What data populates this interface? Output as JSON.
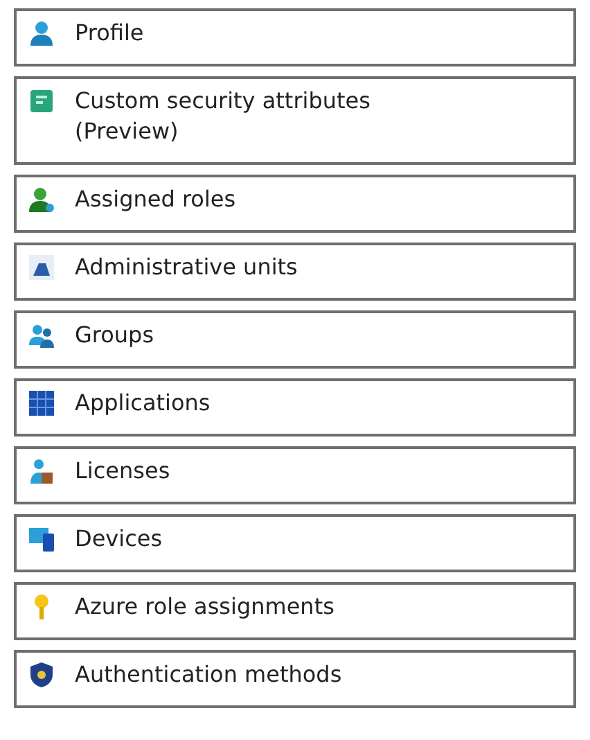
{
  "menu_items": [
    {
      "label": "Profile",
      "kind": "person"
    },
    {
      "label": "Custom security attributes (Preview)",
      "kind": "attributes"
    },
    {
      "label": "Assigned roles",
      "kind": "roles"
    },
    {
      "label": "Administrative units",
      "kind": "units"
    },
    {
      "label": "Groups",
      "kind": "groups"
    },
    {
      "label": "Applications",
      "kind": "apps"
    },
    {
      "label": "Licenses",
      "kind": "licenses"
    },
    {
      "label": "Devices",
      "kind": "devices"
    },
    {
      "label": "Azure role assignments",
      "kind": "key"
    },
    {
      "label": "Authentication methods",
      "kind": "shield"
    }
  ]
}
